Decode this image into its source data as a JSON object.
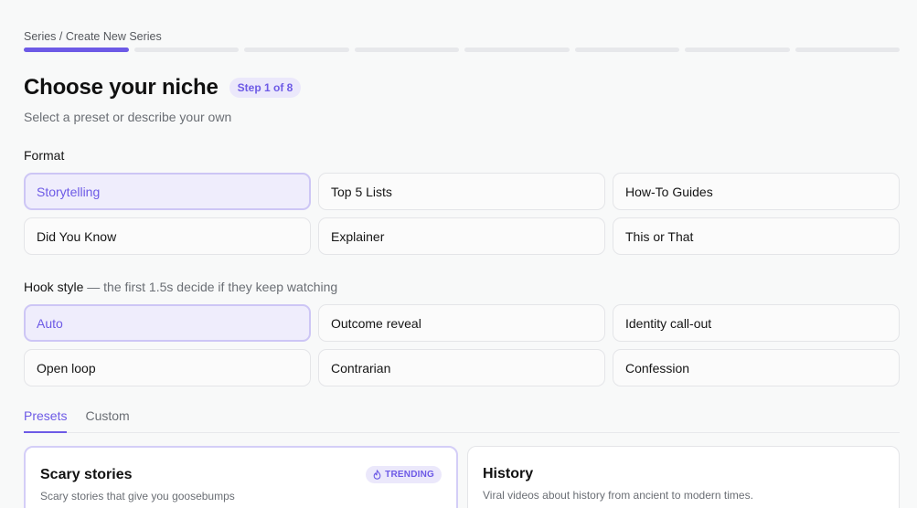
{
  "breadcrumb": "Series / Create New Series",
  "progress": {
    "total_steps": 8,
    "current_step": 1
  },
  "header": {
    "title": "Choose your niche",
    "step_badge": "Step 1 of 8",
    "subtitle": "Select a preset or describe your own"
  },
  "format": {
    "label": "Format",
    "selected": "Storytelling",
    "options": [
      "Storytelling",
      "Top 5 Lists",
      "How-To Guides",
      "Did You Know",
      "Explainer",
      "This or That"
    ]
  },
  "hook": {
    "label": "Hook style",
    "hint": "— the first 1.5s decide if they keep watching",
    "selected": "Auto",
    "options": [
      "Auto",
      "Outcome reveal",
      "Identity call-out",
      "Open loop",
      "Contrarian",
      "Confession"
    ]
  },
  "tabs": [
    {
      "label": "Presets",
      "active": true
    },
    {
      "label": "Custom",
      "active": false
    }
  ],
  "presets": [
    {
      "title": "Scary stories",
      "description": "Scary stories that give you goosebumps",
      "badge": "TRENDING",
      "badge_icon": "flame-icon",
      "selected": true
    },
    {
      "title": "History",
      "description": "Viral videos about history from ancient to modern times.",
      "selected": false
    }
  ],
  "colors": {
    "accent": "#6d5ae6",
    "accent_soft": "#ebe8fb",
    "background": "#f8f9f9"
  }
}
